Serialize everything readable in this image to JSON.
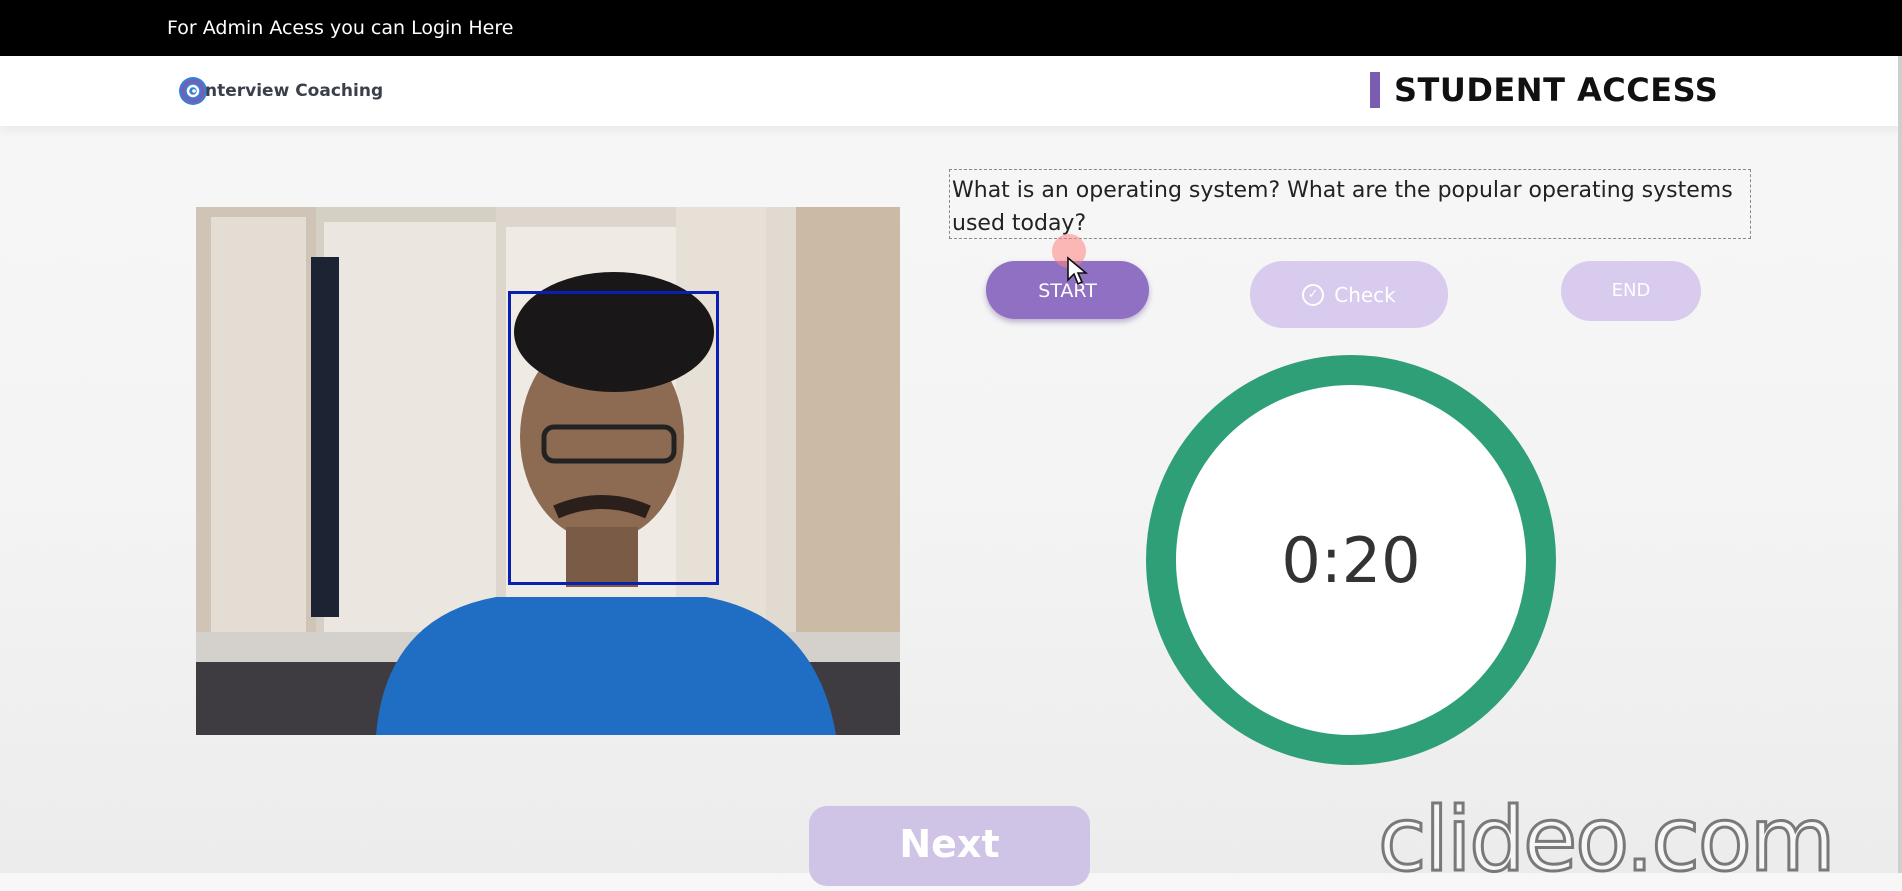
{
  "topbar": {
    "admin_link": "For Admin Acess you can Login Here"
  },
  "header": {
    "logo_text": "nterview Coaching",
    "section_title": "STUDENT ACCESS"
  },
  "question": {
    "text": "What is an operating system? What are the popular operating systems used today?"
  },
  "controls": {
    "start_label": "START",
    "check_label": "Check",
    "end_label": "END",
    "next_label": "Next"
  },
  "timer": {
    "display": "0:20",
    "color": "#2f9f78"
  },
  "watermark": {
    "text": "clideo.com"
  },
  "colors": {
    "accent": "#8f70c2",
    "accent_light": "#d8cbee",
    "face_box": "#0a1fb0"
  },
  "icons": {
    "logo": "spiral-logo-icon",
    "check": "check-circle-icon",
    "cursor": "mouse-cursor-icon"
  }
}
